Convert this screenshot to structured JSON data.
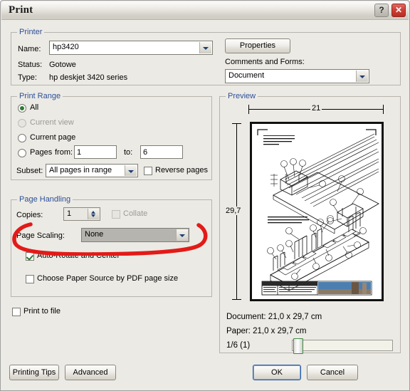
{
  "window": {
    "title": "Print",
    "help_button": "?",
    "close_button": "✕",
    "help_icon": "question-mark-icon",
    "close_icon": "close-x-icon"
  },
  "printer": {
    "group_title": "Printer",
    "name_label": "Name:",
    "name_value": "hp3420",
    "status_label": "Status:",
    "status_value": "Gotowe",
    "type_label": "Type:",
    "type_value": "hp deskjet 3420 series",
    "properties_button": "Properties",
    "comments_label": "Comments and Forms:",
    "comments_value": "Document"
  },
  "print_range": {
    "group_title": "Print Range",
    "all_label": "All",
    "current_view_label": "Current view",
    "current_page_label": "Current page",
    "pages_label": "Pages",
    "from_label": "from:",
    "from_value": "1",
    "to_label": "to:",
    "to_value": "6",
    "subset_label": "Subset:",
    "subset_value": "All pages in range",
    "reverse_label": "Reverse pages",
    "selected": "all"
  },
  "page_handling": {
    "group_title": "Page Handling",
    "copies_label": "Copies:",
    "copies_value": "1",
    "collate_label": "Collate",
    "page_scaling_label": "Page Scaling:",
    "page_scaling_value": "None",
    "auto_rotate_label": "Auto-Rotate and Center",
    "auto_rotate_checked": true,
    "paper_source_label": "Choose Paper Source by PDF page size",
    "paper_source_checked": false
  },
  "print_to_file": {
    "label": "Print to file",
    "checked": false
  },
  "preview": {
    "group_title": "Preview",
    "width_dim": "21",
    "height_dim": "29,7",
    "document_info": "Document: 21,0 x 29,7 cm",
    "paper_info": "Paper: 21,0 x 29,7 cm",
    "page_indicator": "1/6 (1)",
    "drawing": {
      "note_top": "ELEMENT 'P'\nPODSTAWA STOJAKA\n1 SZT.",
      "note_mid": "UWAGA: WSZYSTKIE ELEMENTY\nPODSTAWY MAJA DLUGOSC 1500mm\n(900mm DLA WARIANTU 2)"
    }
  },
  "footer": {
    "printing_tips_button": "Printing Tips",
    "advanced_button": "Advanced",
    "ok_button": "OK",
    "cancel_button": "Cancel"
  },
  "annotation": {
    "shape": "hand-drawn-red-ellipse",
    "color": "#e21b18",
    "target": "page-scaling-combo"
  },
  "colors": {
    "dialog_bg": "#eceae4",
    "group_title": "#2b4f9a",
    "accent_check": "#2e7a35",
    "annotation_red": "#e21b18",
    "close_red": "#cf4036"
  }
}
